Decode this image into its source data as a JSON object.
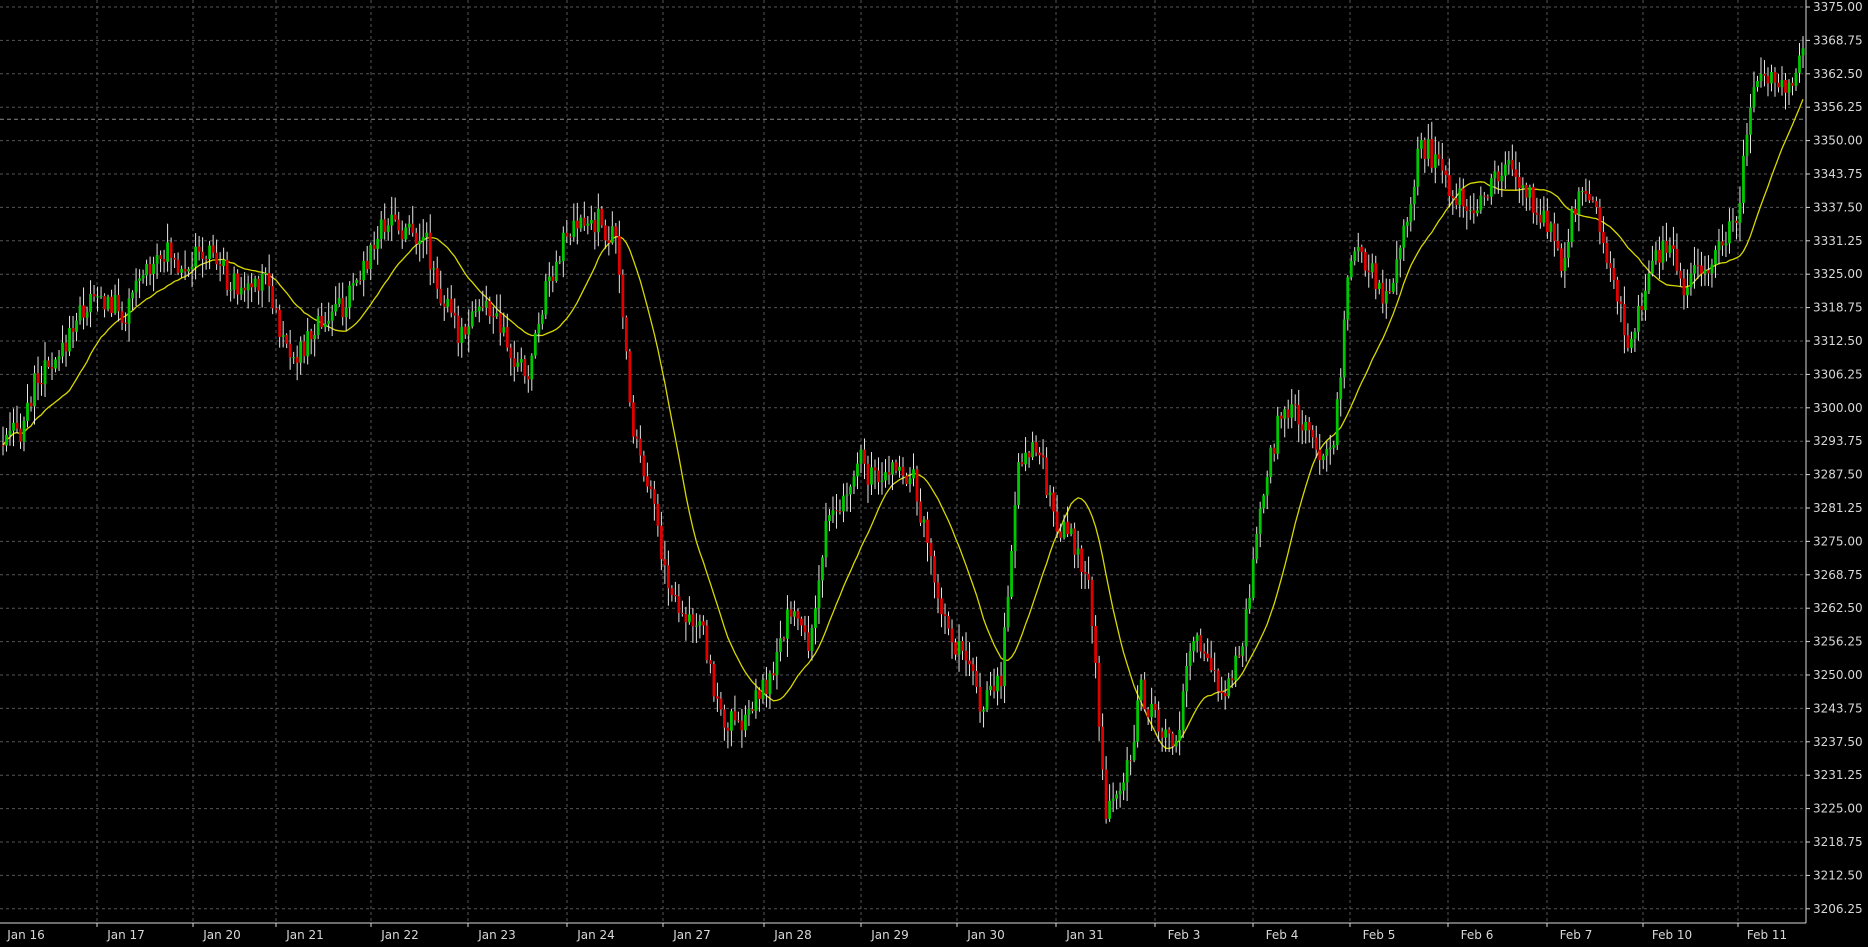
{
  "chart_data": {
    "type": "candlestick",
    "x_tick_labels": [
      "Jan 16",
      "Jan 17",
      "Jan 20",
      "Jan 21",
      "Jan 22",
      "Jan 23",
      "Jan 24",
      "Jan 27",
      "Jan 28",
      "Jan 29",
      "Jan 30",
      "Jan 31",
      "Feb 3",
      "Feb 4",
      "Feb 5",
      "Feb 6",
      "Feb 7",
      "Feb 10",
      "Feb 11"
    ],
    "y_tick_labels": [
      "3375.00",
      "3368.75",
      "3362.50",
      "3356.25",
      "3350.00",
      "3343.75",
      "3337.50",
      "3331.25",
      "3325.00",
      "3318.75",
      "3312.50",
      "3306.25",
      "3300.00",
      "3293.75",
      "3287.50",
      "3281.25",
      "3275.00",
      "3268.75",
      "3262.50",
      "3256.25",
      "3250.00",
      "3243.75",
      "3237.50",
      "3231.25",
      "3225.00",
      "3218.75",
      "3212.50",
      "3206.25"
    ],
    "ylim": [
      3205,
      3375
    ],
    "grid": true,
    "crosshair_y": 3354.0,
    "colors": {
      "background": "#000000",
      "up": "#00c800",
      "down": "#e00000",
      "wick": "#e6e6e6",
      "moving_average": "#d8d800",
      "grid": "#555555",
      "axis_text": "#d8d8d8"
    },
    "price_path": [
      3293,
      3296,
      3306,
      3307,
      3316,
      3320,
      3320,
      3317,
      3325,
      3330,
      3327,
      3328,
      3329,
      3323,
      3322,
      3326,
      3312,
      3310,
      3316,
      3318,
      3321,
      3330,
      3336,
      3333,
      3333,
      3321,
      3314,
      3319,
      3318,
      3309,
      3306,
      3323,
      3331,
      3334,
      3335,
      3331,
      3296,
      3285,
      3266,
      3262,
      3257,
      3242,
      3240,
      3245,
      3250,
      3263,
      3255,
      3277,
      3282,
      3290,
      3285,
      3290,
      3286,
      3271,
      3258,
      3252,
      3244,
      3250,
      3290,
      3294,
      3280,
      3275,
      3267,
      3225,
      3229,
      3247,
      3240,
      3236,
      3258,
      3250,
      3247,
      3260,
      3284,
      3300,
      3298,
      3292,
      3294,
      3329,
      3327,
      3320,
      3334,
      3350,
      3345,
      3340,
      3338,
      3342,
      3345,
      3340,
      3336,
      3328,
      3340,
      3338,
      3322,
      3311,
      3326,
      3331,
      3323,
      3325,
      3330,
      3336,
      3360,
      3362,
      3360,
      3368
    ]
  }
}
